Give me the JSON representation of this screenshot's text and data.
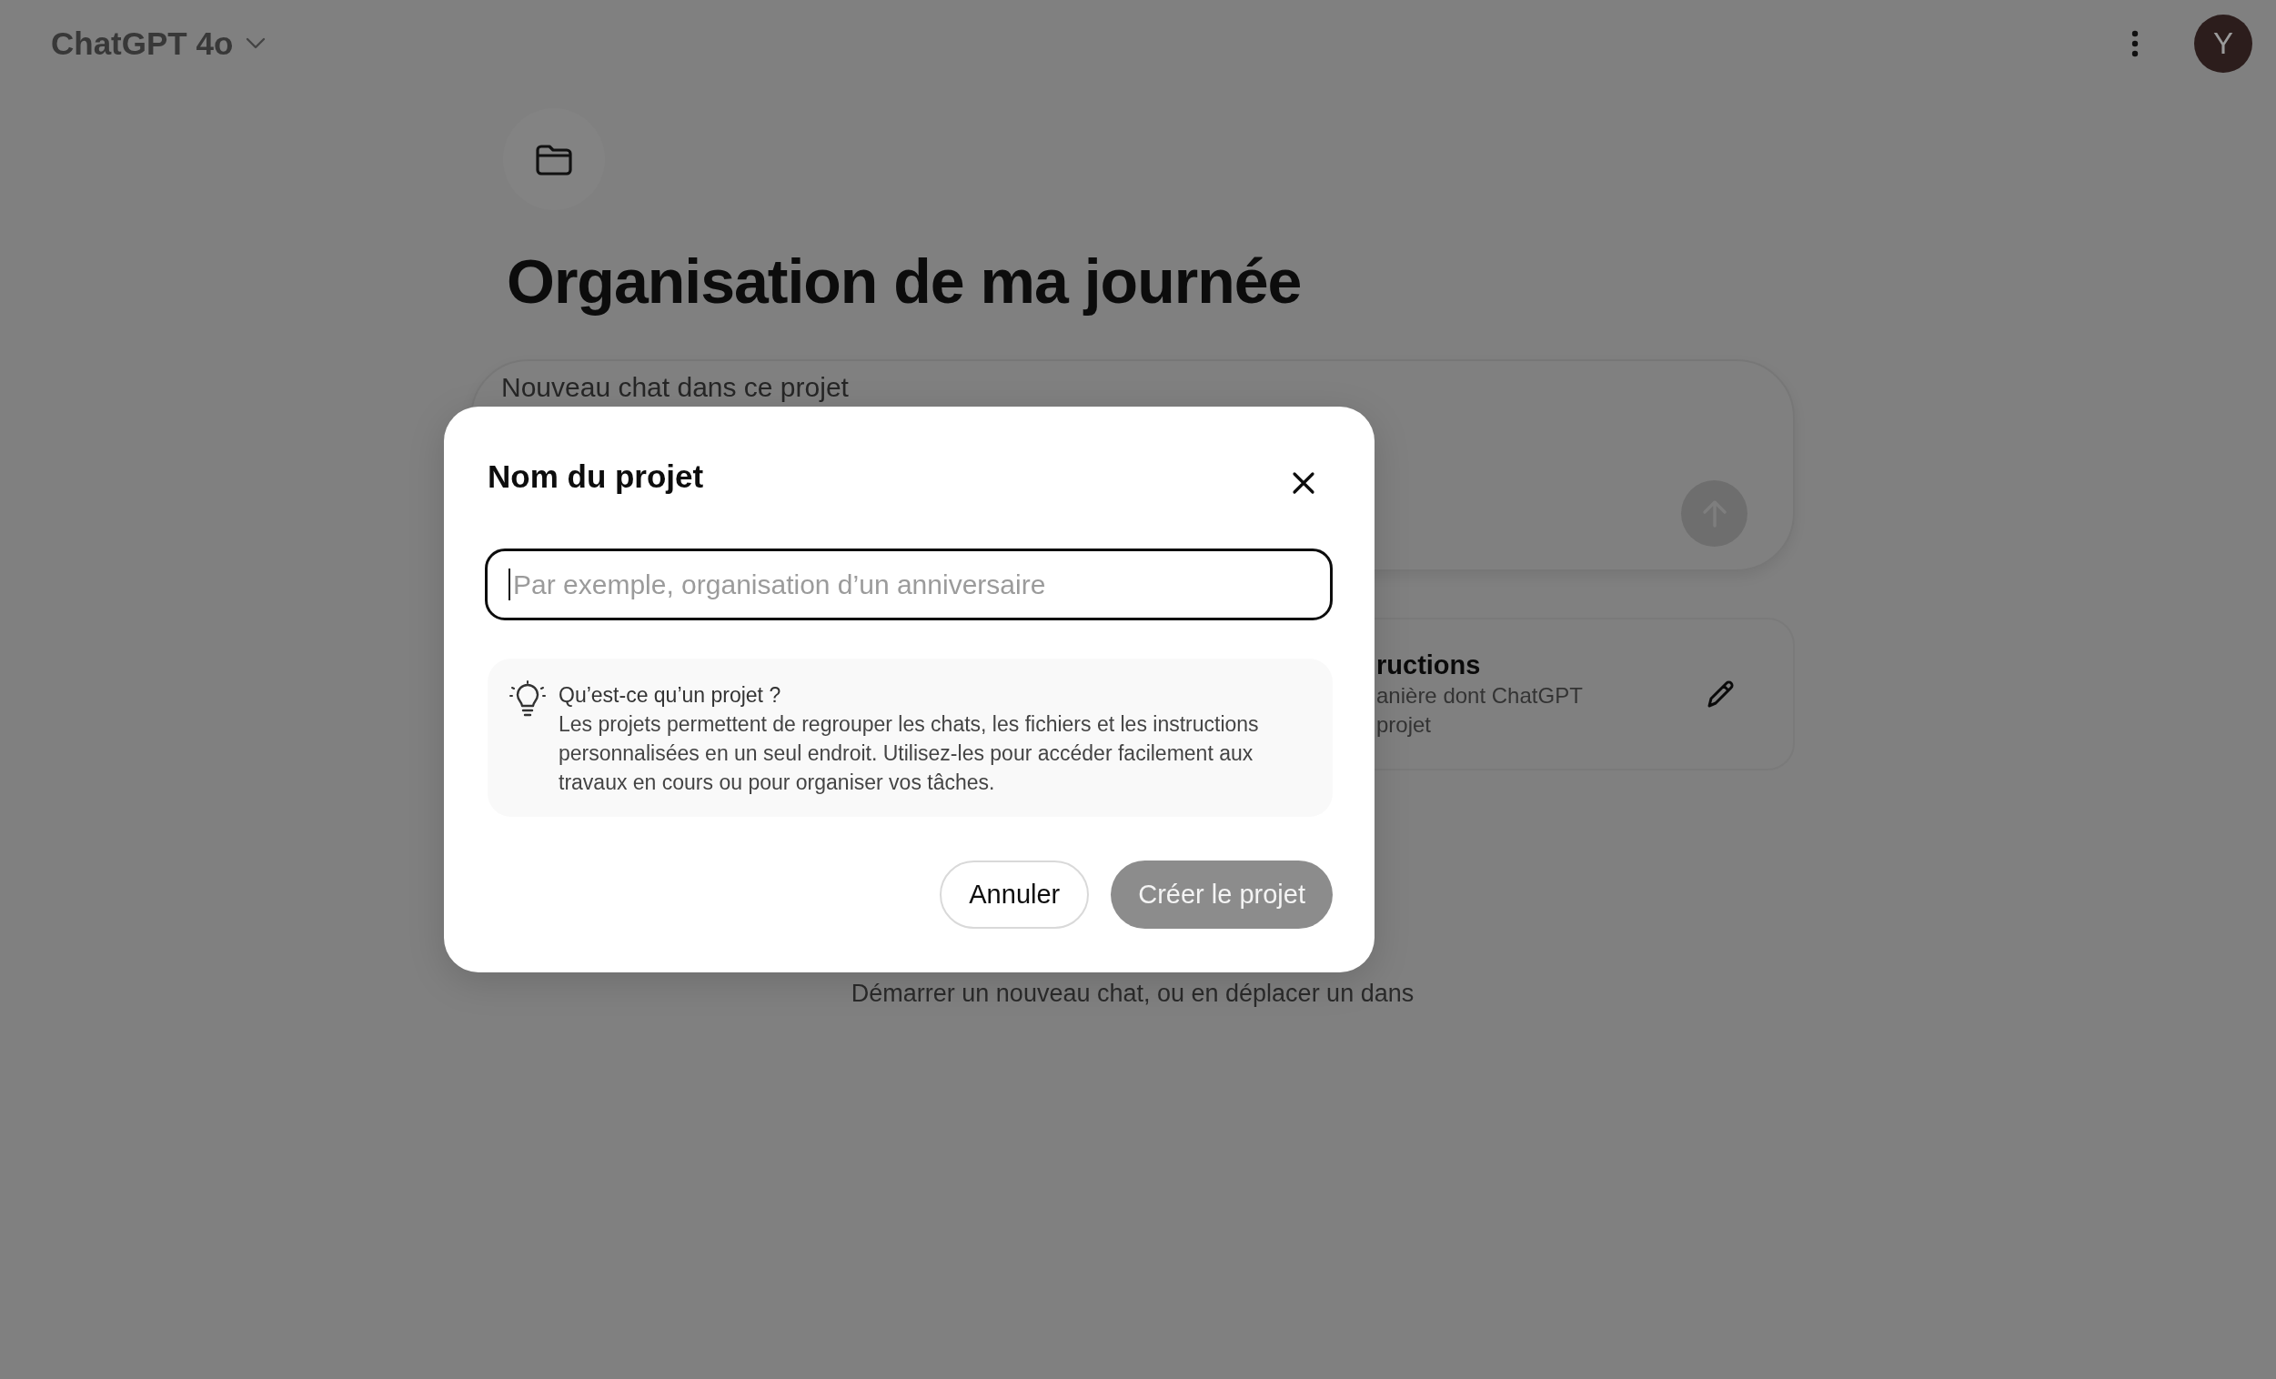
{
  "header": {
    "model_label": "ChatGPT 4o",
    "avatar_initial": "Y"
  },
  "project": {
    "title": "Organisation de ma journée"
  },
  "composer": {
    "placeholder": "Nouveau chat dans ce projet"
  },
  "instructions_card": {
    "title": "ructions",
    "description_lines": [
      "anière dont ChatGPT",
      "projet"
    ]
  },
  "empty_state": {
    "text": "Démarrer un nouveau chat, ou en déplacer un dans"
  },
  "dialog": {
    "title": "Nom du projet",
    "name_field": {
      "placeholder": "Par exemple, organisation d’un anniversaire"
    },
    "info": {
      "heading": "Qu’est-ce qu’un projet ?",
      "body": "Les projets permettent de regrouper les chats, les fichiers et les instructions personnalisées en un seul endroit. Utilisez-les pour accéder facilement aux travaux en cours ou pour organiser vos tâches."
    },
    "buttons": [
      {
        "label": "Annuler",
        "kind": "secondary",
        "disabled": false
      },
      {
        "label": "Créer le projet",
        "kind": "primary",
        "disabled": true
      }
    ]
  }
}
